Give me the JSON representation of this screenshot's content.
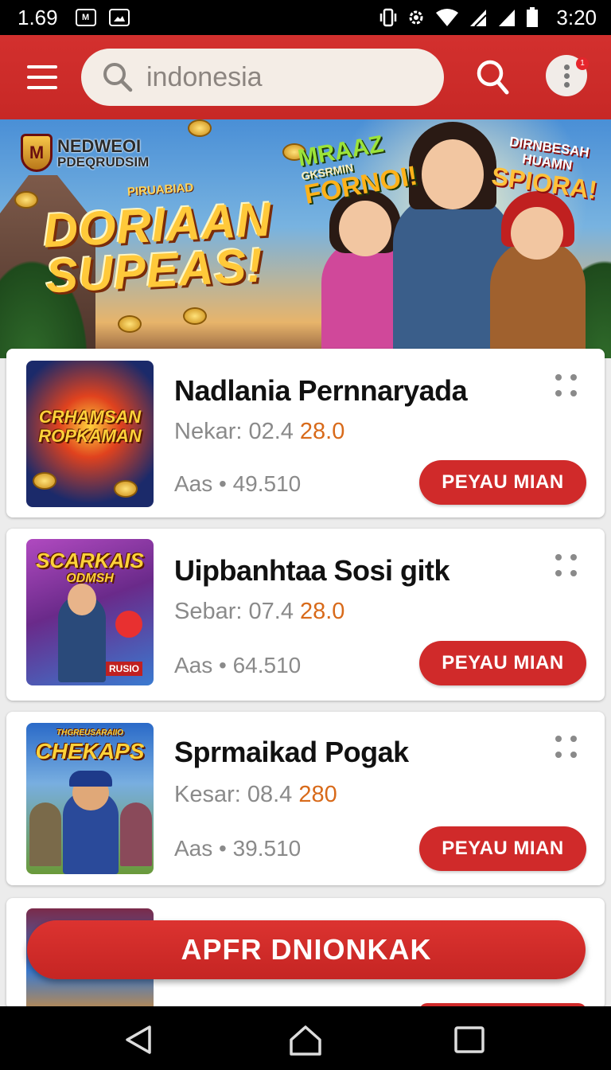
{
  "status_bar": {
    "time_left": "1.69",
    "time_right": "3:20",
    "icons": [
      "app-notification-icon",
      "image-notification-icon",
      "vibrate-icon",
      "settings-icon",
      "wifi-icon",
      "signal-icon",
      "signal-icon",
      "battery-icon"
    ]
  },
  "toolbar": {
    "search_value": "indonesia",
    "notification_count": "1",
    "icons": [
      "menu-icon",
      "search-icon",
      "more-vert-icon"
    ]
  },
  "banner": {
    "logo_letter": "M",
    "logo_line1": "NEDWEOI",
    "logo_line2": "PDEQRUDSIM",
    "subheadline": "PIRUABIAD",
    "headline_line1": "DORIAAN",
    "headline_line2": "SUPEAS!",
    "tag1_small": "GKSRMIN",
    "tag1_line1": "MRAAZ",
    "tag1_line2": "FORNOI!",
    "tag2_line1": "DIRNBESAH",
    "tag2_line2": "HUAMN",
    "tag2_line3": "SPIORA!"
  },
  "games": [
    {
      "thumb_text_line1": "CRHAMSAN",
      "thumb_text_line2": "ROPKAMAN",
      "thumb_colors": [
        "#1b2a6a",
        "#c0321e",
        "#ffb31a"
      ],
      "title": "Nadlania Pernnaryada",
      "meta_label": "Nekar: 02.4",
      "meta_value": "28.0",
      "stat": "Aas • 49.510",
      "button": "PEYAU MIAN"
    },
    {
      "thumb_text_line1": "SCARKAIS",
      "thumb_text_line2": "ODMSH",
      "thumb_badge": "RUSIO",
      "thumb_colors": [
        "#6a2a8a",
        "#b04ac0",
        "#3a7ad0"
      ],
      "title": "Uipbanhtaa Sosi gitk",
      "meta_label": "Sebar: 07.4",
      "meta_value": "28.0",
      "stat": "Aas • 64.510",
      "button": "PEYAU MIAN"
    },
    {
      "thumb_text_line0": "THGREUSARAIIO",
      "thumb_text_line1": "CHEKAPS",
      "thumb_colors": [
        "#2a6ac8",
        "#6a9a3a",
        "#c08a3a"
      ],
      "title": "Sprmaikad Pogak",
      "meta_label": "Kesar: 08.4",
      "meta_value": "280",
      "stat": "Aas • 39.510",
      "button": "PEYAU MIAN"
    }
  ],
  "bottom_cta": "APFR DNIONKAK",
  "nav_bar": {
    "icons": [
      "back-icon",
      "home-icon",
      "recents-icon"
    ]
  },
  "colors": {
    "brand_red": "#c72826",
    "accent_orange": "#d86a1a",
    "card_bg": "#ffffff",
    "page_bg": "#ececec"
  }
}
